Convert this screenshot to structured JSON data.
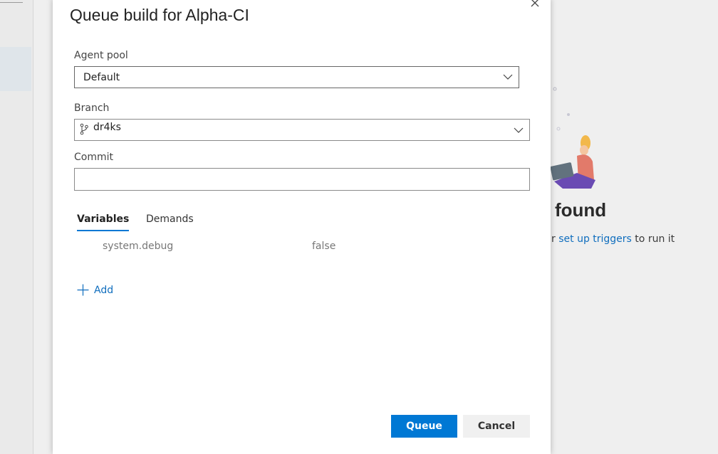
{
  "dialog": {
    "title": "Queue build for Alpha-CI",
    "close_icon": "close-icon",
    "agent_pool": {
      "label": "Agent pool",
      "value": "Default"
    },
    "branch": {
      "label": "Branch",
      "value": "dr4ks",
      "icon": "git-branch-icon"
    },
    "commit": {
      "label": "Commit",
      "value": ""
    },
    "tabs": [
      {
        "label": "Variables",
        "active": true
      },
      {
        "label": "Demands",
        "active": false
      }
    ],
    "variables": [
      {
        "name": "system.debug",
        "value": "false"
      }
    ],
    "add_label": "Add",
    "queue_label": "Queue",
    "cancel_label": "Cancel"
  },
  "background": {
    "title_fragment": "found",
    "subtitle_prefix": "r ",
    "subtitle_link": "set up triggers",
    "subtitle_suffix": " to run it"
  },
  "colors": {
    "accent": "#0078d4",
    "link": "#106ebe"
  }
}
